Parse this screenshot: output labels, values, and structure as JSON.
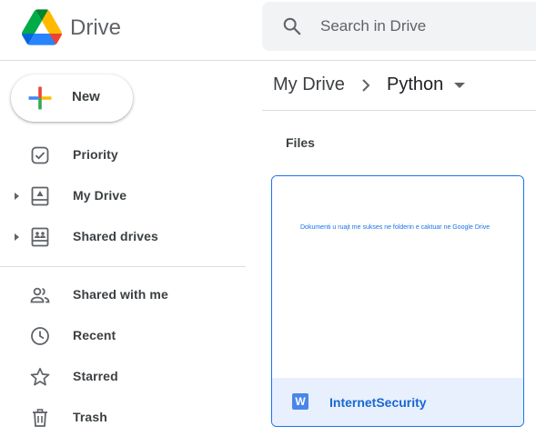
{
  "header": {
    "product_name": "Drive",
    "search": {
      "placeholder": "Search in Drive",
      "value": ""
    }
  },
  "sidebar": {
    "new_label": "New",
    "items": [
      {
        "label": "Priority",
        "icon": "priority-checkbox-icon",
        "expandable": false
      },
      {
        "label": "My Drive",
        "icon": "my-drive-icon",
        "expandable": true
      },
      {
        "label": "Shared drives",
        "icon": "shared-drives-icon",
        "expandable": true
      },
      {
        "label": "Shared with me",
        "icon": "people-icon",
        "expandable": false
      },
      {
        "label": "Recent",
        "icon": "clock-icon",
        "expandable": false
      },
      {
        "label": "Starred",
        "icon": "star-icon",
        "expandable": false
      },
      {
        "label": "Trash",
        "icon": "trash-icon",
        "expandable": false
      }
    ]
  },
  "breadcrumb": {
    "root": "My Drive",
    "current": "Python"
  },
  "main": {
    "section_title": "Files",
    "files": [
      {
        "name": "InternetSecurity",
        "type_icon": "word-doc-icon",
        "type_letter": "W",
        "preview_text": "Dokumenti u ruajt me sukses ne folderin e caktuar ne Google Drive"
      }
    ]
  },
  "colors": {
    "accent": "#1a73e8",
    "selected_bg": "#e8f0fe",
    "search_bg": "#f1f3f4",
    "word_blue": "#4a86e8"
  }
}
